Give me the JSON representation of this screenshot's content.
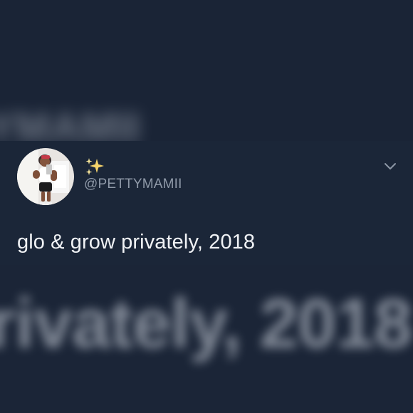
{
  "background": {
    "top_blur_text": "YMAMII",
    "bottom_blur_text": "rivately, 2018"
  },
  "tweet": {
    "display_name_icon": "sparkles-icon",
    "username": "@PETTYMAMII",
    "text": "glo & grow privately, 2018",
    "menu_icon": "chevron-down-icon"
  },
  "colors": {
    "background": "#1b2537",
    "text": "#f0f2f5",
    "muted": "#8f99a8",
    "sparkle": "#f4d36b"
  }
}
